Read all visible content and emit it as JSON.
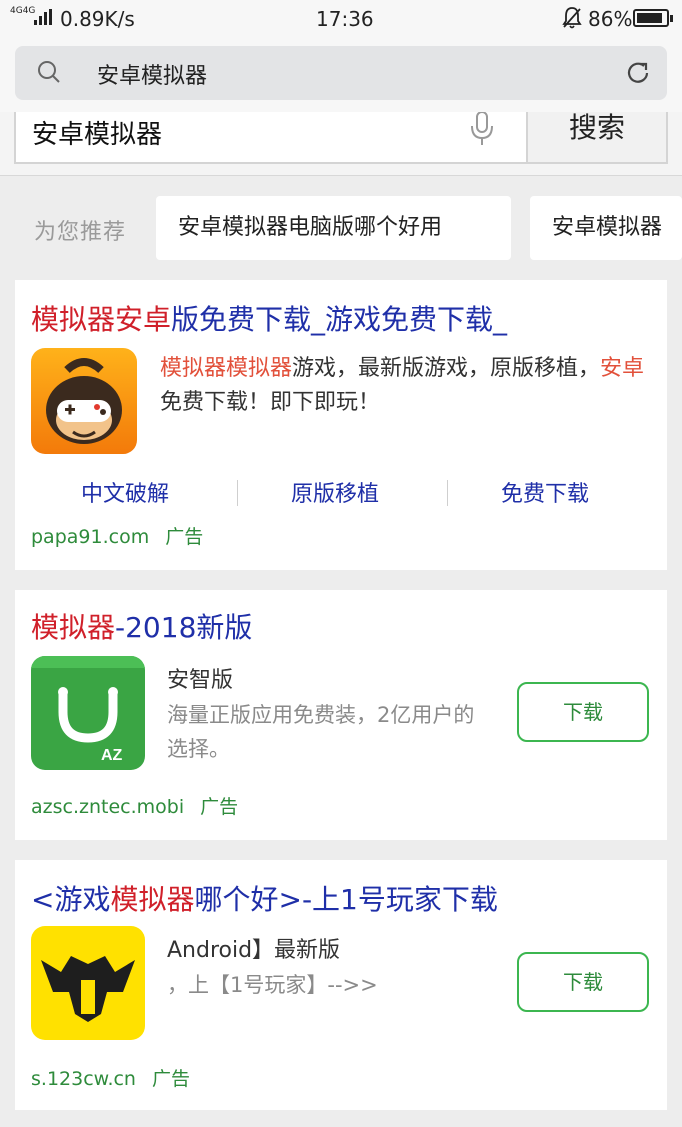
{
  "status_bar": {
    "network": "4G4G",
    "speed": "0.89K/s",
    "time": "17:36",
    "battery": "86%"
  },
  "browser": {
    "url_text": "安卓模拟器",
    "icons": {
      "search": "search-icon",
      "refresh": "refresh-icon"
    }
  },
  "search": {
    "query": "安卓模拟器",
    "button_label": "搜索",
    "mic_icon": "mic-icon"
  },
  "recommend": {
    "label": "为您推荐",
    "chips": [
      "安卓模拟器电脑版哪个好用",
      "安卓模拟器"
    ]
  },
  "results": [
    {
      "title_part1": "模拟器安卓",
      "title_part2": "版免费下载_游戏免费下载_",
      "desc_hl1": "模拟器模拟器",
      "desc_text1": "游戏，最新版游戏，原版移植，",
      "desc_hl2": "安卓",
      "desc_text2": "免费下载！即下即玩！",
      "sitelinks": [
        "中文破解",
        "原版移植",
        "免费下载"
      ],
      "url": "papa91.com",
      "ad_label": "广告",
      "icon": "monkey-gamepad-app-icon"
    },
    {
      "title_part1": "模拟器",
      "title_part2": "-2018新版",
      "app_name": "安智版",
      "app_desc": "海量正版应用免费装，2亿用户的选择。",
      "button": "下载",
      "url": "azsc.zntec.mobi",
      "ad_label": "广告",
      "icon": "anzhi-market-app-icon"
    },
    {
      "title_part1": "<游戏",
      "title_part2": "模拟器",
      "title_part3": "哪个好>-上1号玩家下载",
      "app_name": "Android】最新版",
      "app_desc": "，上【1号玩家】-->>",
      "button": "下载",
      "url": "s.123cw.cn",
      "ad_label": "广告",
      "icon": "helmet-app-icon"
    }
  ],
  "colors": {
    "link_blue": "#1f2fa8",
    "highlight_red": "#d0202a",
    "ad_green": "#2e8b3b",
    "button_green": "#3cb650"
  }
}
